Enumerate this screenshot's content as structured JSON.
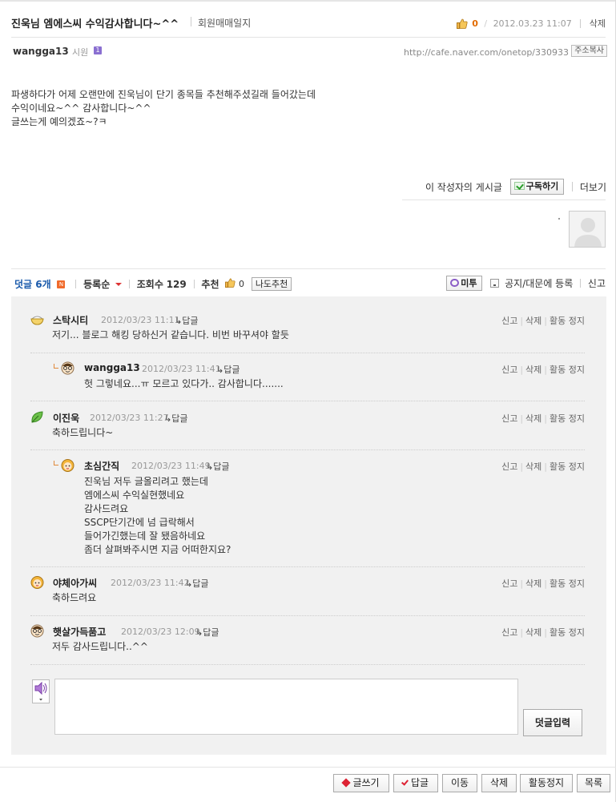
{
  "post": {
    "title": "진욱님 엠에스씨 수익감사합니다~^^",
    "board": "회원매매일지",
    "likes": "0",
    "date": "2012.03.23 11:07",
    "delete_label": "삭제",
    "author": "wangga13",
    "role": "시원",
    "rank_badge": "1",
    "url": "http://cafe.naver.com/onetop/330933",
    "copy_url_label": "주소복사",
    "body": [
      "파생하다가 어제 오랜만에 진욱님이 단기 종목들 추천해주셨길래 들어갔는데",
      "수익이네요~^^ 감사합니다~^^",
      "글쓰는게 예의겠죠~?ㅋ"
    ],
    "author_posts_label": "이 작성자의 게시글",
    "subscribe_label": "구독하기",
    "more_label": "더보기"
  },
  "comments_bar": {
    "comments_label": "덧글 6개",
    "new_badge": "N",
    "sort_label": "등록순",
    "views_label": "조회수",
    "views_value": "129",
    "recommend_label": "추천",
    "recommend_value": "0",
    "me_too_recommend_label": "나도추천",
    "metoo_label": "미투",
    "notice_label": "공지/대문에 등록",
    "report_label": "신고"
  },
  "comment_actions": [
    "신고",
    "삭제",
    "활동 정지"
  ],
  "reply_label": "답글",
  "comments": [
    {
      "name": "스탁시티",
      "date": "2012/03/23 11:11",
      "lines": [
        "저기... 블로그 해킹 당하신거 같습니다. 비번 바꾸셔야 할듯"
      ]
    },
    {
      "name": "wangga13",
      "date": "2012/03/23 11:41",
      "lines": [
        "헛 그렇네요...ㅠ 모르고 있다가.. 감사합니다......."
      ]
    },
    {
      "name": "이진욱",
      "date": "2012/03/23 11:27",
      "lines": [
        "축하드립니다~"
      ]
    },
    {
      "name": "초심간직",
      "date": "2012/03/23 11:49",
      "lines": [
        "진욱님 저두 글올리려고 했는데",
        "엠에스씨 수익실현했네요",
        "감사드려요",
        "SSCP단기간에 넘 급락해서",
        "들어가긴했는데 잘 됐음하네요",
        "좀더 살펴봐주시면 지금 어떠한지요?"
      ]
    },
    {
      "name": "야체아가씨",
      "date": "2012/03/23 11:42",
      "lines": [
        "축하드려요"
      ]
    },
    {
      "name": "햇살가득품고",
      "date": "2012/03/23 12:09",
      "lines": [
        "저두 감사드립니다..^^"
      ]
    }
  ],
  "comment_submit_label": "덧글입력",
  "bottom_buttons": {
    "write": "글쓰기",
    "reply": "답글",
    "move": "이동",
    "delete": "삭제",
    "suspend": "활동정지",
    "list": "목록"
  },
  "colors": {
    "accent_blue": "#1a5aab",
    "like_orange": "#e26b00",
    "comment_bg": "#f1f1f1"
  }
}
